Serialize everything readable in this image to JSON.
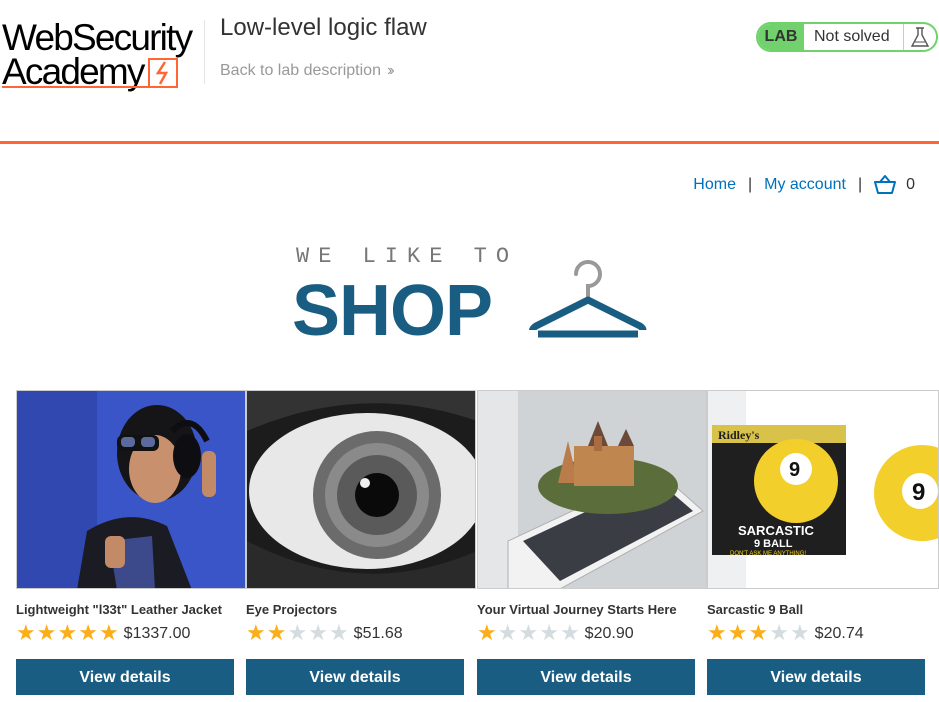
{
  "header": {
    "logo_line1": "WebSecurity",
    "logo_line2": "Academy",
    "lab_title": "Low-level logic flaw",
    "back_link": "Back to lab description",
    "status_badge": "LAB",
    "status_text": "Not solved"
  },
  "nav": {
    "home": "Home",
    "separator": "|",
    "my_account": "My account",
    "cart_count": "0"
  },
  "banner": {
    "small": "WE LIKE TO",
    "big": "SHOP"
  },
  "products": [
    {
      "name": "Lightweight \"l33t\" Leather Jacket",
      "rating": 5,
      "price": "$1337.00",
      "button": "View details"
    },
    {
      "name": "Eye Projectors",
      "rating": 2,
      "price": "$51.68",
      "button": "View details"
    },
    {
      "name": "Your Virtual Journey Starts Here",
      "rating": 1,
      "price": "$20.90",
      "button": "View details"
    },
    {
      "name": "Sarcastic 9 Ball",
      "rating": 3,
      "price": "$20.74",
      "button": "View details"
    }
  ],
  "product_images": {
    "ball_brand": "Ridley's",
    "ball_number": "9",
    "ball_title": "SARCASTIC",
    "ball_subtitle": "9 BALL",
    "ball_tagline": "DON'T ASK ME ANYTHING!"
  },
  "colors": {
    "accent": "#ff6633",
    "link": "#0071bc",
    "button": "#1a5d82",
    "status_green": "#70d16d",
    "star_on": "#fcae19",
    "star_off": "#d4dce0"
  }
}
